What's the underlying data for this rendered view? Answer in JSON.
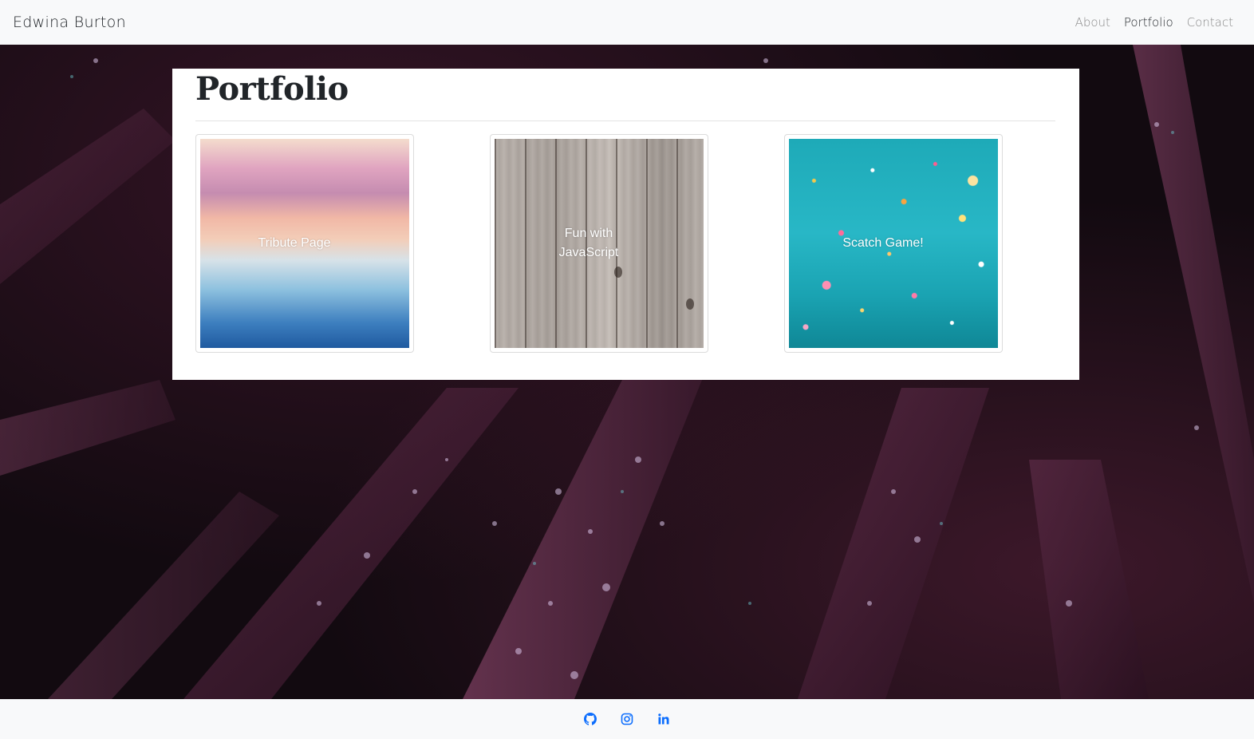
{
  "navbar": {
    "brand": "Edwina Burton",
    "links": [
      {
        "label": "About",
        "active": false
      },
      {
        "label": "Portfolio",
        "active": true
      },
      {
        "label": "Contact",
        "active": false
      }
    ]
  },
  "portfolio": {
    "title": "Portfolio",
    "projects": [
      {
        "label": "Tribute Page",
        "image": "sunset-over-water"
      },
      {
        "label": "Fun with JavaScript",
        "image": "weathered-wood-planks"
      },
      {
        "label": "Scatch Game!",
        "image": "teal-confetti"
      }
    ]
  },
  "footer": {
    "icons": [
      "github-icon",
      "instagram-icon",
      "linkedin-icon"
    ],
    "icon_color": "#0d6efd"
  },
  "colors": {
    "navbar_bg": "#f8f9fa",
    "panel_bg": "#ffffff",
    "hero_bg": "#120a10"
  }
}
